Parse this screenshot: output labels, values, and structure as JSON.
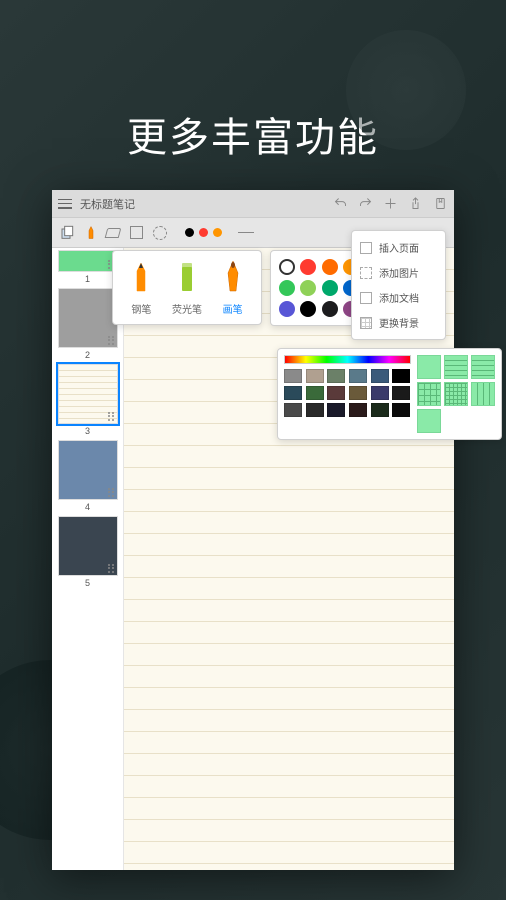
{
  "headline": "更多丰富功能",
  "app": {
    "title": "无标题笔记",
    "toolbar": {
      "current_colors": [
        "#000000",
        "#ff0000",
        "#ff9500"
      ]
    },
    "pens": {
      "items": [
        {
          "label": "钢笔",
          "color": "#ff8c00"
        },
        {
          "label": "荧光笔",
          "color": "#9acd32"
        },
        {
          "label": "画笔",
          "color": "#ff8c00"
        }
      ],
      "active_index": 2
    },
    "color_palette": {
      "swatches": [
        "#ffffff",
        "#ff3b30",
        "#ff6b00",
        "#ff9500",
        "#ffcc00",
        "#34c759",
        "#8fd158",
        "#00a86b",
        "#0066cc",
        "#003d82",
        "#5856d6",
        "#000000",
        "#1c1c1e",
        "#8e4585",
        "#af52de"
      ]
    },
    "menu": {
      "items": [
        {
          "label": "插入页面",
          "icon": "page"
        },
        {
          "label": "添加图片",
          "icon": "image"
        },
        {
          "label": "添加文档",
          "icon": "doc"
        },
        {
          "label": "更换背景",
          "icon": "grid"
        }
      ]
    },
    "style_panel": {
      "palette": [
        "#8a8a8a",
        "#b0a090",
        "#6b8068",
        "#5a7a8a",
        "#3a5a7a",
        "#000000",
        "#2a4a5a",
        "#3a6a3a",
        "#5a3a3a",
        "#6a5a3a",
        "#3a3a6a",
        "#1a1a1a",
        "#4a4a4a",
        "#2a2a2a",
        "#1a1a2a",
        "#2a1a1a",
        "#1a2a1a",
        "#0a0a0a"
      ]
    },
    "thumbnails": [
      {
        "num": "1",
        "bg": "#6bdb8e",
        "short": true
      },
      {
        "num": "2",
        "bg": "#9e9e9e"
      },
      {
        "num": "3",
        "bg": "#fcf9ee",
        "selected": true
      },
      {
        "num": "4",
        "bg": "#6b88ab"
      },
      {
        "num": "5",
        "bg": "#3a4550"
      }
    ]
  }
}
